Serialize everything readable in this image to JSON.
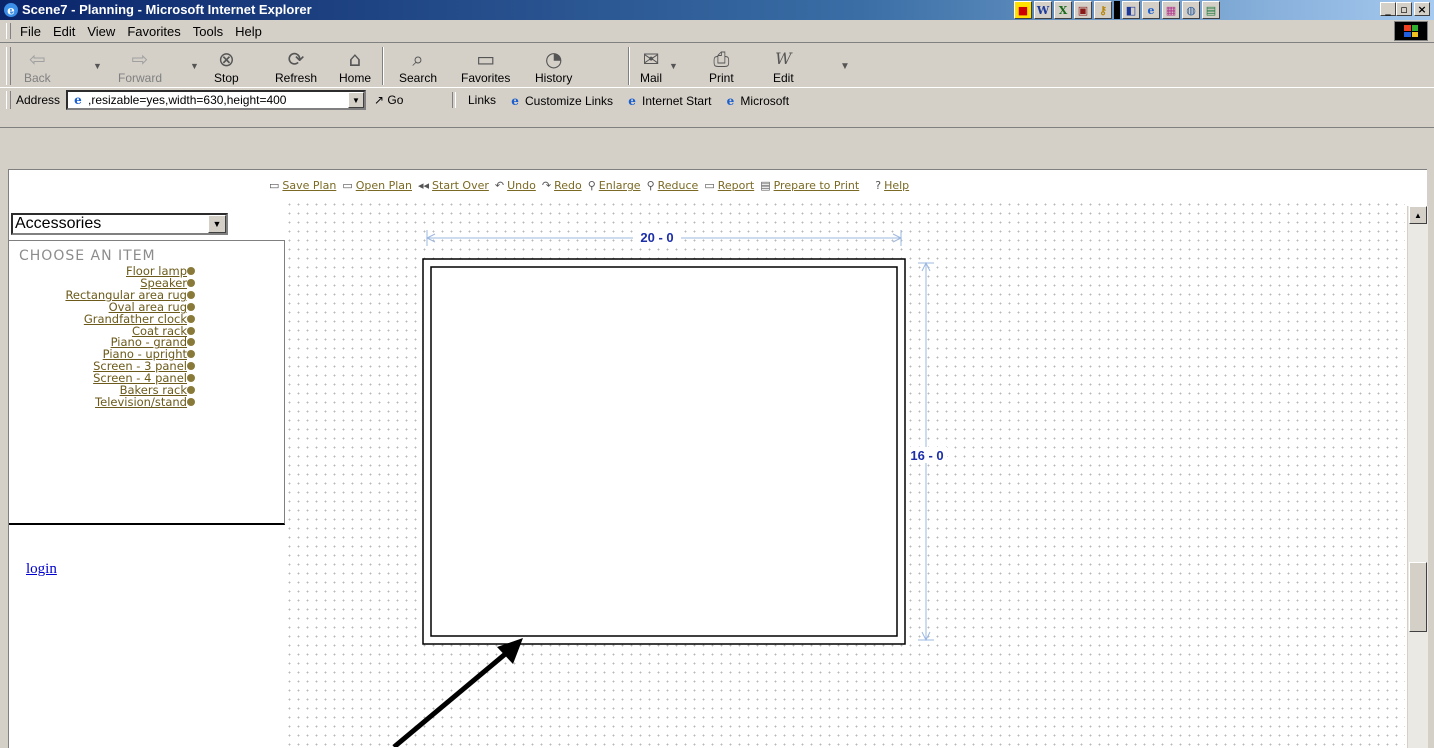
{
  "window": {
    "title": "Scene7 - Planning - Microsoft Internet Explorer",
    "tray_icons": [
      "W",
      "X",
      "▣",
      "🔍",
      "",
      "◧",
      "e",
      "W",
      "◍",
      "▦"
    ],
    "buttons": {
      "minimize": "_",
      "maximize": "▫",
      "close": "×"
    }
  },
  "menubar": {
    "items": [
      {
        "label": "File"
      },
      {
        "label": "Edit"
      },
      {
        "label": "View"
      },
      {
        "label": "Favorites"
      },
      {
        "label": "Tools"
      },
      {
        "label": "Help"
      }
    ]
  },
  "toolbar": {
    "back": "Back",
    "forward": "Forward",
    "stop": "Stop",
    "refresh": "Refresh",
    "home": "Home",
    "search": "Search",
    "favorites": "Favorites",
    "history": "History",
    "mail": "Mail",
    "print": "Print",
    "edit": "Edit"
  },
  "address": {
    "label": "Address",
    "value": ",resizable=yes,width=630,height=400",
    "go": "Go",
    "links_label": "Links",
    "links": [
      "Customize Links",
      "Internet Start",
      "Microsoft"
    ]
  },
  "pagebar": {
    "items": [
      {
        "icon": "▭",
        "label": "Save Plan"
      },
      {
        "icon": "▭",
        "label": "Open Plan"
      },
      {
        "icon": "◂◂",
        "label": "Start Over"
      },
      {
        "icon": "↶",
        "label": "Undo"
      },
      {
        "icon": "↷",
        "label": "Redo"
      },
      {
        "icon": "⚲",
        "label": "Enlarge"
      },
      {
        "icon": "⚲",
        "label": "Reduce"
      },
      {
        "icon": "▭",
        "label": "Report"
      },
      {
        "icon": "▤",
        "label": "Prepare to Print"
      },
      {
        "icon": "?",
        "label": "Help"
      }
    ]
  },
  "sidebar": {
    "category": "Accessories",
    "choose_header": "CHOOSE AN ITEM",
    "items": [
      "Floor lamp",
      "Speaker",
      "Rectangular area rug",
      "Oval area rug",
      "Grandfather clock",
      "Coat rack",
      "Piano - grand",
      "Piano - upright",
      "Screen - 3 panel",
      "Screen - 4 panel",
      "Bakers rack",
      "Television/stand"
    ],
    "login": "login"
  },
  "plan": {
    "width_label": "20 - 0",
    "height_label": "16 - 0",
    "dimension_color": "#9db8e0",
    "label_color": "#1c2ea8"
  }
}
